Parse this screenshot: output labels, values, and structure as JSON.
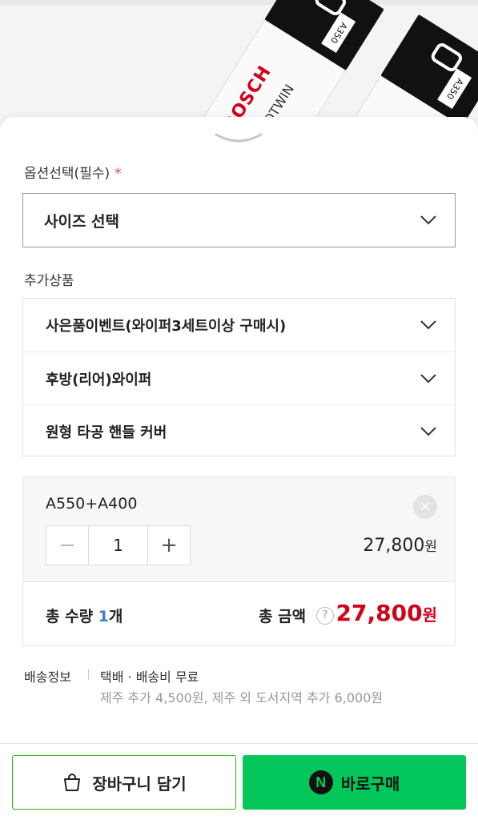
{
  "product_image": {
    "brand": "BOSCH",
    "line": "AEROTWIN",
    "model_tag": "A350"
  },
  "options": {
    "label": "옵션선택(필수)",
    "required_mark": "*",
    "size_select": "사이즈 선택"
  },
  "addons": {
    "label": "추가상품",
    "items": [
      {
        "label": "사은품이벤트(와이퍼3세트이상 구매시)"
      },
      {
        "label": "후방(리어)와이퍼"
      },
      {
        "label": "원형 타공 핸들 커버"
      }
    ]
  },
  "selected_item": {
    "name": "A550+A400",
    "quantity": "1",
    "minus": "−",
    "plus": "+",
    "remove": "×",
    "price": "27,800",
    "currency": "원"
  },
  "totals": {
    "qty_prefix": "총 수량 ",
    "qty_value": "1",
    "qty_suffix": "개",
    "amount_label": "총 금액",
    "help": "?",
    "amount": "27,800",
    "currency": "원"
  },
  "shipping": {
    "label": "배송정보",
    "main": "택배 · 배송비 무료",
    "sub": "제주 추가 4,500원, 제주 외 도서지역 추가 6,000원"
  },
  "footer": {
    "cart_label": "장바구니 담기",
    "buy_label": "바로구매",
    "n_logo": "N"
  },
  "colors": {
    "accent_green": "#03c75a",
    "price_red": "#d0021b",
    "qty_blue": "#3a7bd5"
  }
}
